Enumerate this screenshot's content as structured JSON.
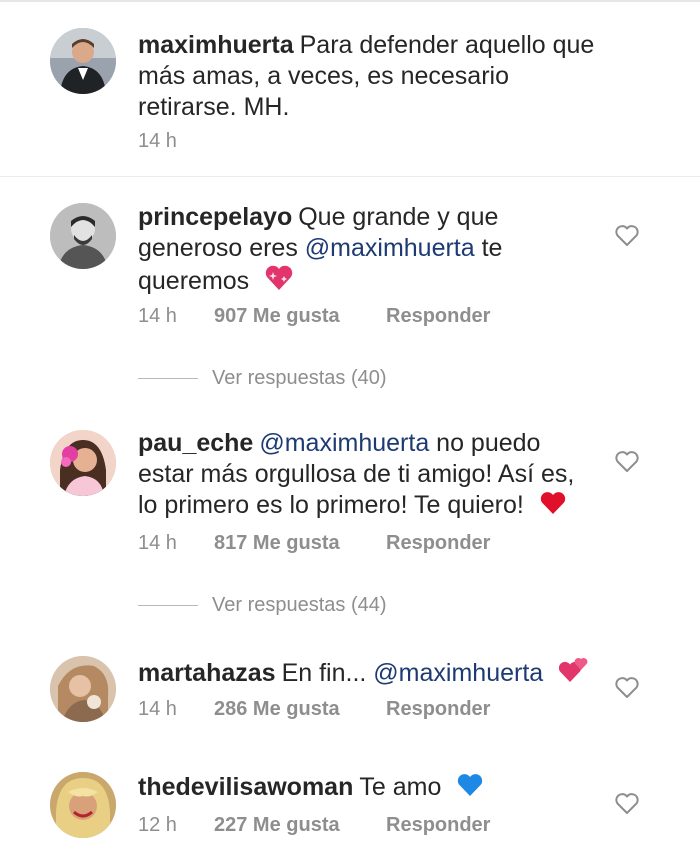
{
  "comments": [
    {
      "username": "maximhuerta",
      "text": "Para defender aquello que más amas, a veces, es necesario retirarse. MH.",
      "time": "14 h"
    },
    {
      "username": "princepelayo",
      "text_before": "Que grande y que generoso eres",
      "mention": "@maximhuerta",
      "text_after": "te queremos",
      "emoji": "sparkling-heart",
      "time": "14 h",
      "likes": "907 Me gusta",
      "reply": "Responder",
      "view_replies": "Ver respuestas (40)"
    },
    {
      "username": "pau_eche",
      "mention": "@maximhuerta",
      "text_after": "no puedo estar más orgullosa de ti amigo! Así es, lo primero es lo primero! Te quiero!",
      "emoji": "red-heart",
      "time": "14 h",
      "likes": "817 Me gusta",
      "reply": "Responder",
      "view_replies": "Ver respuestas (44)"
    },
    {
      "username": "martahazas",
      "text_before": "En fin...",
      "mention": "@maximhuerta",
      "emoji": "two-hearts",
      "time": "14 h",
      "likes": "286 Me gusta",
      "reply": "Responder"
    },
    {
      "username": "thedevilisawoman",
      "text_before": "Te amo",
      "emoji": "blue-heart",
      "time": "12 h",
      "likes": "227 Me gusta",
      "reply": "Responder"
    }
  ],
  "colors": {
    "text": "#262626",
    "meta": "#8e8e8e",
    "mention": "#1d3a73",
    "red_heart": "#e0102b",
    "blue_heart": "#1e88e5"
  }
}
